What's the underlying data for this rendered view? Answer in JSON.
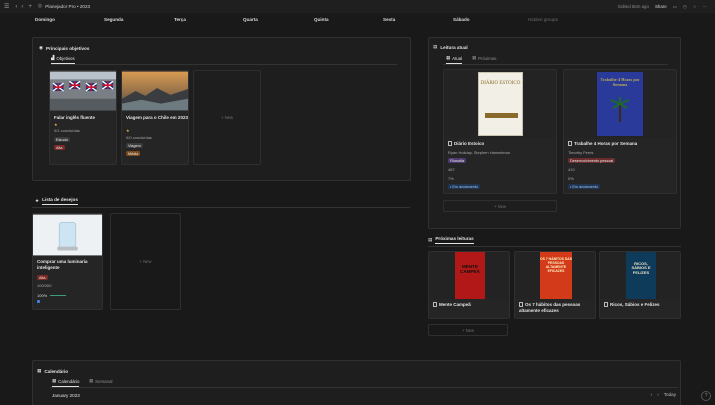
{
  "topbar": {
    "breadcrumb": "Planejador Pro • 2023",
    "edited": "Edited 56m ago",
    "share": "Share"
  },
  "days": [
    "Domingo",
    "Segunda",
    "Terça",
    "Quarta",
    "Quinta",
    "Sexta",
    "Sábado",
    "Hidden groups"
  ],
  "objectives": {
    "title": "Principais objetivos",
    "tab": "Objetivos",
    "cards": [
      {
        "title": "Falar inglês fluente",
        "progress": "0/1 concluídas",
        "category": "Estudo",
        "priority": "Alta",
        "stars": "★"
      },
      {
        "title": "Viagem para o Chile em 2023",
        "progress": "0/0 concluídas",
        "category": "Viagem",
        "priority": "Média",
        "stars": "★"
      }
    ],
    "new_label": "+ New"
  },
  "wishlist": {
    "title": "Lista de desejos",
    "card": {
      "title": "Comprar uma luminaria inteligente",
      "priority": "Alta",
      "price": "100/300",
      "percent": "100%",
      "progress": 1.0
    },
    "new_label": "+ New"
  },
  "reading": {
    "title": "Leitura atual",
    "tabs": [
      "Atual",
      "Próximas"
    ],
    "cards": [
      {
        "cover_title": "DIÁRIO ESTOICO",
        "title": "Diário Estoico",
        "author": "Ryan Holiday, Stephen Hanselman",
        "genre": "Filosofia",
        "pages": "487",
        "percent": "7%",
        "status": "Em andamento",
        "cover_bg": "#f2efe6",
        "cover_fg": "#8a6a2a"
      },
      {
        "cover_title": "Trabalhe 4 Horas por Semana",
        "title": "Trabalhe 4 Horas por Semana",
        "author": "Timothy Ferris",
        "genre": "Desenvolvimento pessoal",
        "pages": "410",
        "percent": "0%",
        "status": "Em andamento",
        "cover_bg": "#2a3a9a",
        "cover_fg": "#f4d23a"
      }
    ],
    "new_label": "+ New"
  },
  "next_reads": {
    "title": "Próximas leituras",
    "books": [
      {
        "title": "Mente Campeã",
        "cover_text": "MENTE CAMPEÃ",
        "cover_bg": "#b31818"
      },
      {
        "title": "Os 7 hábitos das pessoas altamente eficazes",
        "cover_text": "OS 7 HÁBITOS DAS PESSOAS ALTAMENTE EFICAZES",
        "cover_bg": "#d23a1a"
      },
      {
        "title": "Ricos, Sábios e Felizes",
        "cover_text": "RICOS, SÁBIOS E FELIZES",
        "cover_bg": "#0e3b5a"
      }
    ],
    "new_label": "+ New"
  },
  "calendar": {
    "title": "Calendário",
    "tabs": [
      "Calendário",
      "Semanal"
    ],
    "month": "January 2023",
    "today": "Today"
  }
}
